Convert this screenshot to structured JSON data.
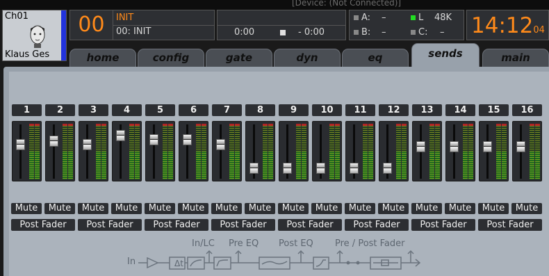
{
  "header": {
    "connection_text": "[Device: (Not Connected)]",
    "channel": {
      "number": "Ch01",
      "name": "Klaus Ges"
    },
    "scene": {
      "number": "00",
      "name": "INIT",
      "current": "00: INIT"
    },
    "transport": {
      "elapsed": "0:00",
      "remaining": "- 0:00"
    },
    "io": {
      "a_label": "A:",
      "a_value": "–",
      "b_label": "B:",
      "b_value": "–",
      "l_label": "L",
      "l_value": "48K",
      "c_label": "C:",
      "c_value": "–"
    },
    "clock": {
      "time": "14:12",
      "seconds": "04"
    }
  },
  "tabs": [
    {
      "label": "home",
      "active": false
    },
    {
      "label": "config",
      "active": false
    },
    {
      "label": "gate",
      "active": false
    },
    {
      "label": "dyn",
      "active": false
    },
    {
      "label": "eq",
      "active": false
    },
    {
      "label": "sends",
      "active": true
    },
    {
      "label": "main",
      "active": false
    }
  ],
  "sends": {
    "buses": [
      "1",
      "2",
      "3",
      "4",
      "5",
      "6",
      "7",
      "8",
      "9",
      "10",
      "11",
      "12",
      "13",
      "14",
      "15",
      "16"
    ],
    "fader_levels": [
      0.64,
      0.73,
      0.64,
      0.85,
      0.75,
      0.75,
      0.64,
      0.13,
      0.13,
      0.13,
      0.13,
      0.13,
      0.6,
      0.6,
      0.6,
      0.6
    ],
    "meter_levels": [
      0.5,
      0.5,
      0.5,
      0.5,
      0.5,
      0.5,
      0.5,
      0.5,
      0.5,
      0.5,
      0.5,
      0.5,
      0.5,
      0.5,
      0.5,
      0.5
    ],
    "mute_label": "Mute",
    "tap_labels": [
      "Post Fader",
      "Post Fader",
      "Post Fader",
      "Post Fader",
      "Post Fader",
      "Post Fader",
      "Post Fader",
      "Post Fader"
    ]
  },
  "signal_flow": {
    "in": "In",
    "delay": "Δt",
    "in_lc": "In/LC",
    "pre_eq": "Pre EQ",
    "post_eq": "Post EQ",
    "pre_post_fader": "Pre / Post Fader"
  },
  "colors": {
    "accent_orange": "#ff8a1a",
    "panel": "#98a1ab",
    "meter_green": "#1d6b1d",
    "channel_blue": "#2233dd"
  }
}
